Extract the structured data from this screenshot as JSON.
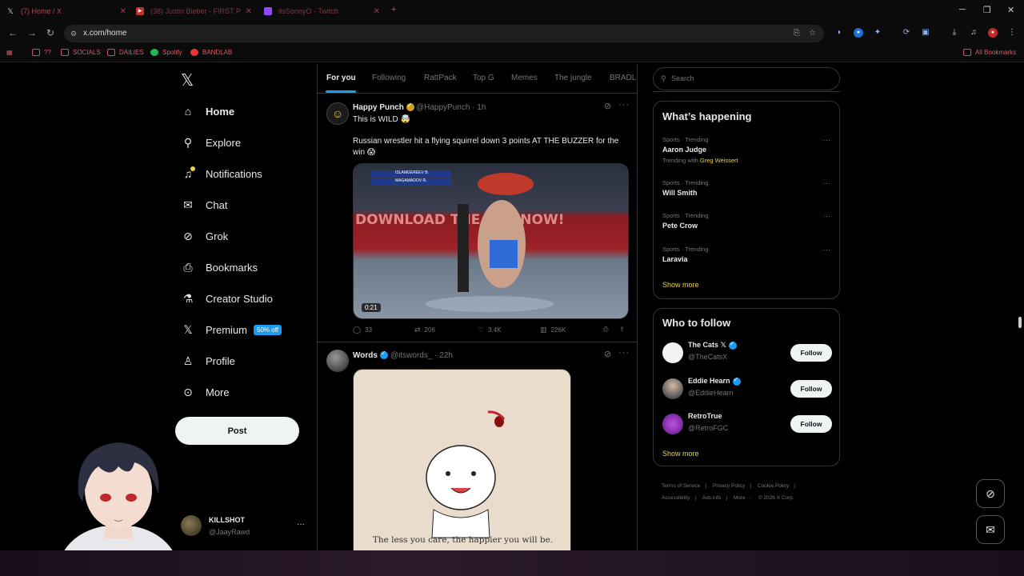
{
  "browser": {
    "tabs": [
      {
        "label": "(7) Home / X",
        "icon": "x-logo-icon"
      },
      {
        "label": "(38) Justin Bieber - FIRST P",
        "icon": "youtube-icon"
      },
      {
        "label": "itsSonnyO - Twitch",
        "icon": "twitch-icon"
      }
    ],
    "new_tab": "+",
    "url": "x.com/home",
    "bookmarks": [
      {
        "label": "??",
        "icon": "folder-icon"
      },
      {
        "label": "SOCIALS",
        "icon": "folder-icon"
      },
      {
        "label": "DAILIES",
        "icon": "folder-icon"
      },
      {
        "label": "Spotify",
        "icon": "spotify-icon"
      },
      {
        "label": "BANDLAB",
        "icon": "bandlab-icon"
      }
    ],
    "all_bookmarks": "All Bookmarks"
  },
  "sidebar": {
    "logo": "𝕏",
    "items": [
      {
        "label": "Home",
        "icon": "home-icon",
        "active": true
      },
      {
        "label": "Explore",
        "icon": "search-icon"
      },
      {
        "label": "Notifications",
        "icon": "bell-icon"
      },
      {
        "label": "Chat",
        "icon": "mail-icon"
      },
      {
        "label": "Grok",
        "icon": "grok-icon"
      },
      {
        "label": "Bookmarks",
        "icon": "bookmark-icon"
      },
      {
        "label": "Creator Studio",
        "icon": "flask-icon"
      },
      {
        "label": "Premium",
        "icon": "x-premium-icon",
        "badge": "50% off"
      },
      {
        "label": "Profile",
        "icon": "person-icon"
      },
      {
        "label": "More",
        "icon": "more-circle-icon"
      }
    ],
    "post_button": "Post",
    "user": {
      "name": "KILLSHOT",
      "handle": "@JaayRawd",
      "more": "···"
    }
  },
  "timeline": {
    "tabs": [
      "For you",
      "Following",
      "RattPack",
      "Top G",
      "Memes",
      "The jungle",
      "BRADLE"
    ],
    "posts": [
      {
        "name": "Happy Punch",
        "handle": "@HappyPunch",
        "time": "· 1h",
        "text1": "This is WILD 🤯",
        "text2": "Russian wrestler hit a flying squirrel down 3 points AT THE BUZZER for the win 😱",
        "video_duration": "0:21",
        "video_banner": "DOWNLOAD THE APP NOW!",
        "score_top": "ISLAMGEREEV B.",
        "score_bottom": "MAGAMADOV R.",
        "replies": "33",
        "reposts": "206",
        "likes": "3.4K",
        "views": "226K"
      },
      {
        "name": "Words",
        "handle": "@itswords_",
        "time": "· 22h",
        "image_caption": "The less you care, the happier you will be."
      }
    ]
  },
  "right": {
    "search_placeholder": "Search",
    "happening_title": "What’s happening",
    "trends": [
      {
        "meta": "Sports · Trending",
        "title": "Aaron Judge",
        "with_label": "Trending with",
        "with_name": "Greg Weissert"
      },
      {
        "meta": "Sports · Trending",
        "title": "Will Smith"
      },
      {
        "meta": "Sports · Trending",
        "title": "Pete Crow"
      },
      {
        "meta": "Sports · Trending",
        "title": "Laravia"
      }
    ],
    "show_more": "Show more",
    "follow_title": "Who to follow",
    "follow": [
      {
        "name": "The Cats 𝕏",
        "handle": "@TheCatsX",
        "button": "Follow"
      },
      {
        "name": "Eddie Hearn",
        "handle": "@EddieHearn",
        "button": "Follow"
      },
      {
        "name": "RetroTrue",
        "handle": "@RetroFGC",
        "button": "Follow"
      }
    ],
    "footer": [
      "Terms of Service",
      "Privacy Policy",
      "Cookie Policy",
      "Accessibility",
      "Ads info",
      "More ···",
      "© 2026 X Corp."
    ]
  },
  "colors": {
    "accent": "#1d9bf0",
    "link_gold": "#e8d44d",
    "bg": "#000000",
    "border": "#2f3336"
  }
}
